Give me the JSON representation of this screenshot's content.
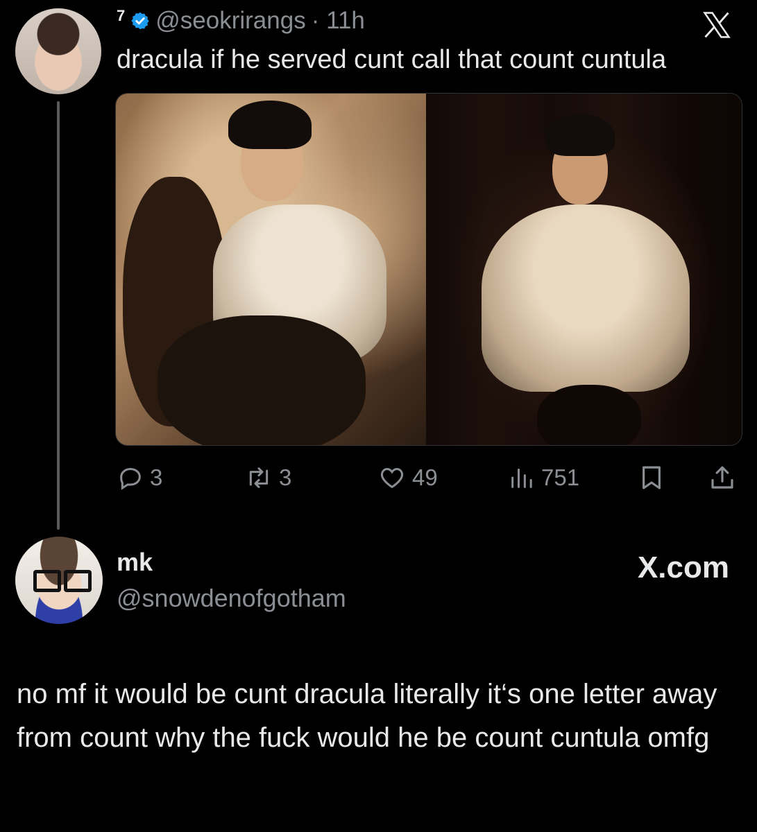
{
  "colors": {
    "background": "#000000",
    "text_primary": "#e7e9ea",
    "text_secondary": "#8b8f94",
    "verified_blue": "#1d9bf0"
  },
  "tweet": {
    "author_name": "7",
    "verified_icon": "verified-badge-icon",
    "handle": "@seokrirangs",
    "time": "· 11h",
    "platform_icon": "x-logo-icon",
    "text": "dracula if he served cunt call that count cuntula",
    "media": [
      {
        "description_icon": "photo-left"
      },
      {
        "description_icon": "photo-right"
      }
    ],
    "actions": {
      "replies": "3",
      "reposts": "3",
      "likes": "49",
      "views": "751",
      "icons": [
        "reply-icon",
        "repost-icon",
        "like-icon",
        "views-icon",
        "bookmark-icon",
        "share-icon"
      ]
    }
  },
  "reply": {
    "author_name": "mk",
    "handle": "@snowdenofgotham",
    "brand": "X.com",
    "text": "no mf it would be cunt dracula literally it‘s one letter away from count why the fuck would he be count cuntula omfg"
  }
}
